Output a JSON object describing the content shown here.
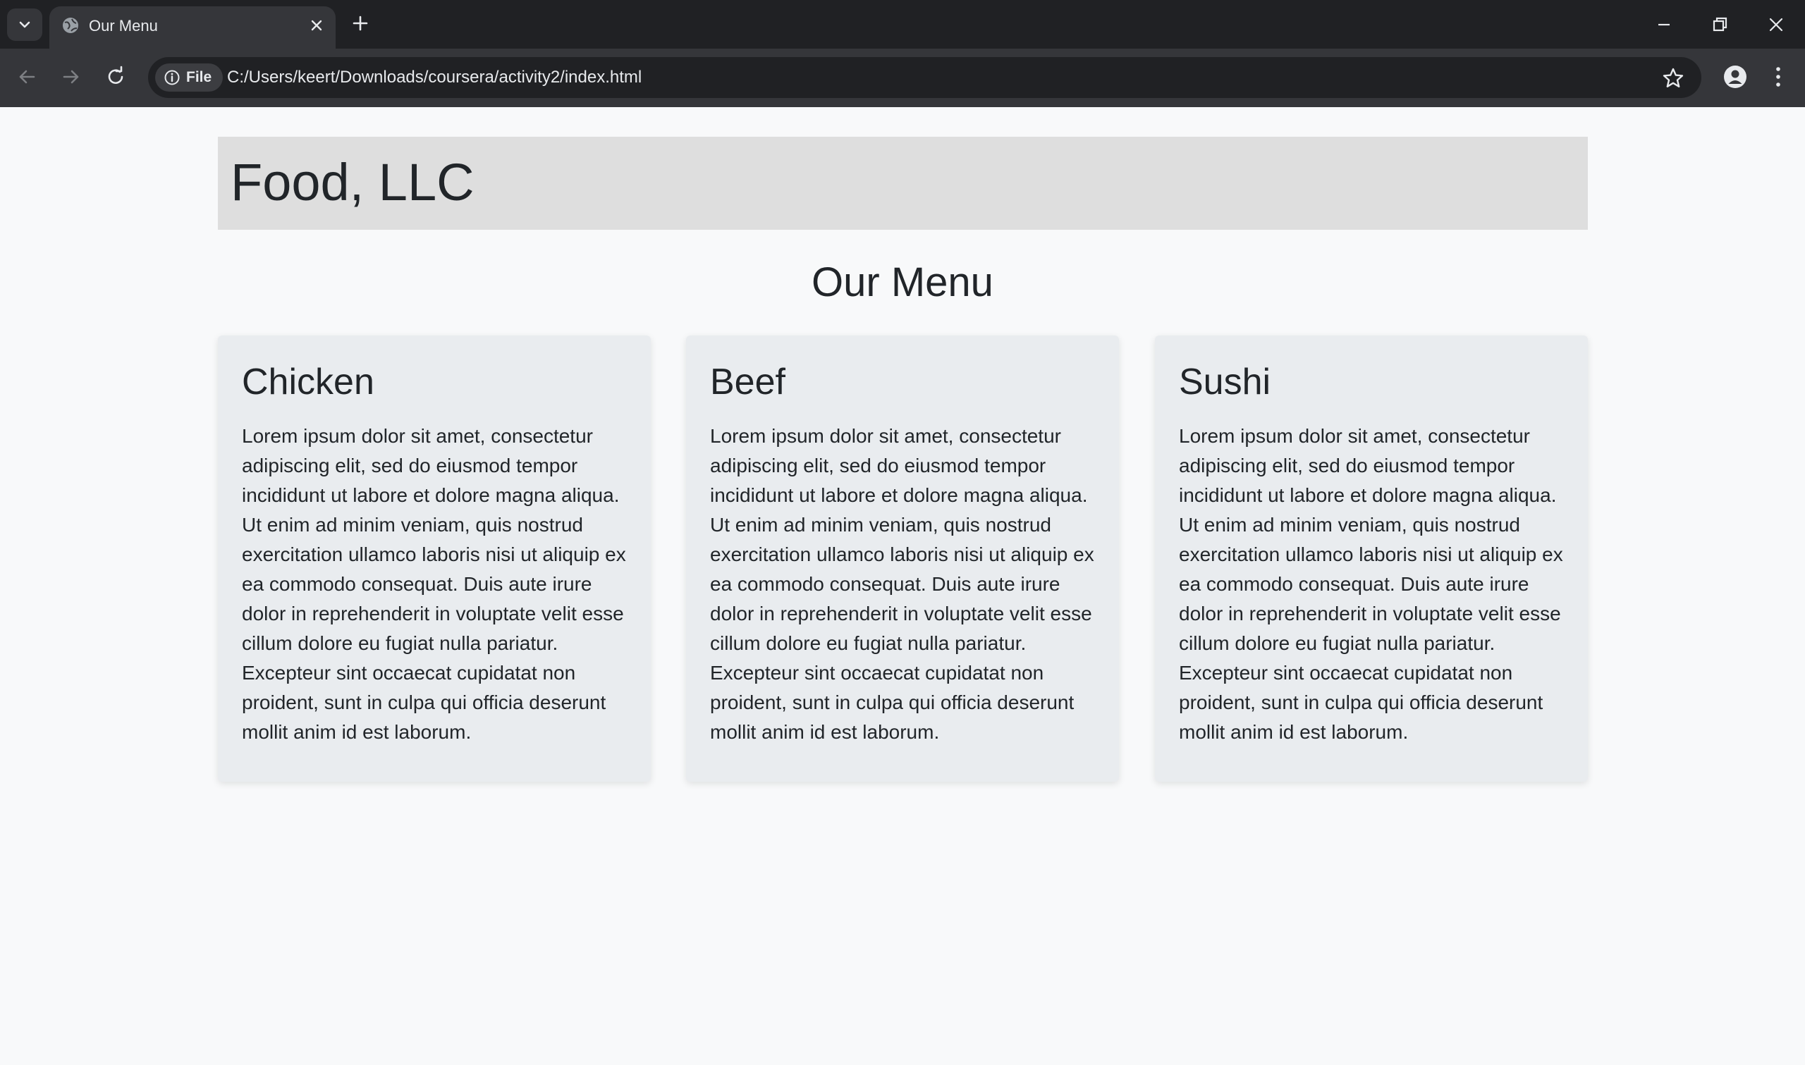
{
  "browser": {
    "tab_title": "Our Menu",
    "site_chip_label": "File",
    "url": "C:/Users/keert/Downloads/coursera/activity2/index.html"
  },
  "page": {
    "company": "Food, LLC",
    "section_title": "Our Menu",
    "cards": [
      {
        "title": "Chicken",
        "text": "Lorem ipsum dolor sit amet, consectetur adipiscing elit, sed do eiusmod tempor incididunt ut labore et dolore magna aliqua. Ut enim ad minim veniam, quis nostrud exercitation ullamco laboris nisi ut aliquip ex ea commodo consequat. Duis aute irure dolor in reprehenderit in voluptate velit esse cillum dolore eu fugiat nulla pariatur. Excepteur sint occaecat cupidatat non proident, sunt in culpa qui officia deserunt mollit anim id est laborum."
      },
      {
        "title": "Beef",
        "text": "Lorem ipsum dolor sit amet, consectetur adipiscing elit, sed do eiusmod tempor incididunt ut labore et dolore magna aliqua. Ut enim ad minim veniam, quis nostrud exercitation ullamco laboris nisi ut aliquip ex ea commodo consequat. Duis aute irure dolor in reprehenderit in voluptate velit esse cillum dolore eu fugiat nulla pariatur. Excepteur sint occaecat cupidatat non proident, sunt in culpa qui officia deserunt mollit anim id est laborum."
      },
      {
        "title": "Sushi",
        "text": "Lorem ipsum dolor sit amet, consectetur adipiscing elit, sed do eiusmod tempor incididunt ut labore et dolore magna aliqua. Ut enim ad minim veniam, quis nostrud exercitation ullamco laboris nisi ut aliquip ex ea commodo consequat. Duis aute irure dolor in reprehenderit in voluptate velit esse cillum dolore eu fugiat nulla pariatur. Excepteur sint occaecat cupidatat non proident, sunt in culpa qui officia deserunt mollit anim id est laborum."
      }
    ]
  },
  "icons": {
    "tab_list": "chevron-down-icon",
    "favicon": "globe-icon",
    "tab_close": "close-icon",
    "new_tab": "plus-icon",
    "minimize": "minimize-icon",
    "restore": "restore-icon",
    "close_window": "close-icon",
    "back": "arrow-left-icon",
    "forward": "arrow-right-icon",
    "reload": "reload-icon",
    "info": "info-icon",
    "bookmark": "star-icon",
    "profile": "person-icon",
    "menu": "kebab-menu-icon"
  },
  "colors": {
    "tabbar_bg": "#202124",
    "toolbar_bg": "#35363a",
    "page_bg": "#f8f9fa",
    "header_bg": "#dedede",
    "card_bg": "#e9ecef",
    "text": "#212529"
  }
}
